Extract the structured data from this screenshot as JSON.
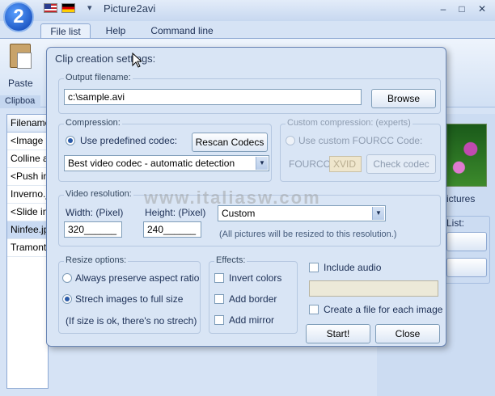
{
  "app": {
    "logo_text": "2",
    "title": "Picture2avi",
    "qa_arrow": "▾",
    "win_buttons": [
      "–",
      "□",
      "✕"
    ]
  },
  "tabs": [
    "File list",
    "Help",
    "Command line"
  ],
  "ribbon": {
    "paste_label": "Paste",
    "group_label": "Clipboa"
  },
  "filelist": {
    "header": "Filename",
    "rows": [
      "<Image f",
      "Colline az",
      "<Push in",
      "Inverno.j",
      "<Slide in",
      "Ninfee.jp",
      "Tramonto"
    ],
    "selected_index": 5
  },
  "right_panel": {
    "thumb_label": "ictures",
    "list_label": "List:"
  },
  "dialog": {
    "title": "Clip creation settings:",
    "output": {
      "label": "Output filename:",
      "value": "c:\\sample.avi",
      "browse": "Browse"
    },
    "compression": {
      "label": "Compression:",
      "use_predefined": "Use predefined codec:",
      "rescan": "Rescan Codecs",
      "codec_value": "Best video codec - automatic detection"
    },
    "custom_compression": {
      "label": "Custom compression: (experts)",
      "use_custom": "Use custom FOURCC Code:",
      "fourcc_label": "FOURCC:",
      "fourcc_value": "XVID",
      "check_codec": "Check codec"
    },
    "resolution": {
      "label": "Video resolution:",
      "width_label": "Width: (Pixel)",
      "height_label": "Height: (Pixel)",
      "width_value": "320______",
      "height_value": "240______",
      "preset": "Custom",
      "note": "(All pictures will be resized to this resolution.)"
    },
    "resize": {
      "label": "Resize options:",
      "preserve": "Always preserve aspect ratio",
      "stretch": "Strech images to full size",
      "note": "(If size is ok, there's no strech)"
    },
    "effects": {
      "label": "Effects:",
      "invert": "Invert colors",
      "border": "Add border",
      "mirror": "Add mirror"
    },
    "include_audio": "Include audio",
    "create_file_each": "Create a file for each image",
    "start": "Start!",
    "close": "Close"
  },
  "watermark": "www.italiasw.com"
}
